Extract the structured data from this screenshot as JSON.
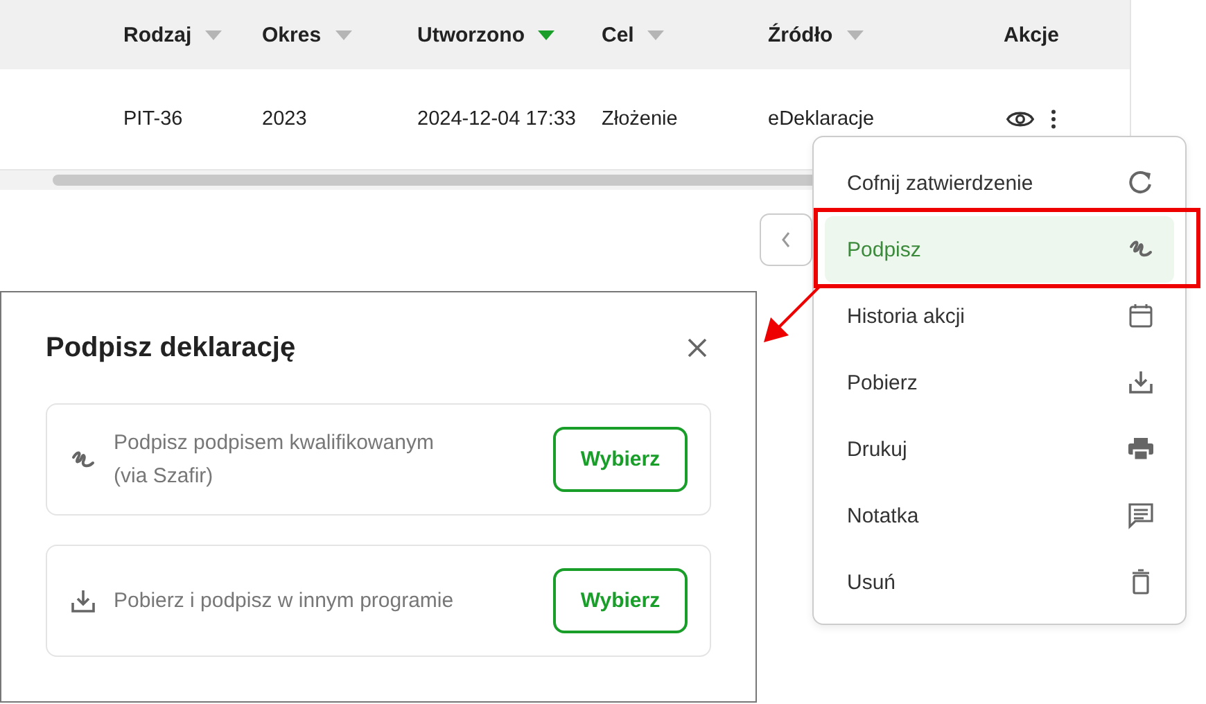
{
  "table": {
    "columns": [
      {
        "label": "Rodzaj",
        "sortable": true,
        "sorted": false
      },
      {
        "label": "Okres",
        "sortable": true,
        "sorted": false
      },
      {
        "label": "Utworzono",
        "sortable": true,
        "sorted": true
      },
      {
        "label": "Cel",
        "sortable": true,
        "sorted": false
      },
      {
        "label": "Źródło",
        "sortable": true,
        "sorted": false
      },
      {
        "label": "Akcje",
        "sortable": false,
        "sorted": false
      }
    ],
    "rows": [
      {
        "cells": [
          "PIT-36",
          "2023",
          "2024-12-04 17:33",
          "Złożenie",
          "eDeklaracje"
        ]
      }
    ]
  },
  "actions_menu": {
    "items": [
      {
        "label": "Cofnij zatwierdzenie",
        "kind": "refresh",
        "selected": false,
        "annotated": false
      },
      {
        "label": "Podpisz",
        "kind": "signature",
        "selected": true,
        "annotated": true
      },
      {
        "label": "Historia akcji",
        "kind": "calendar",
        "selected": false,
        "annotated": false
      },
      {
        "label": "Pobierz",
        "kind": "download",
        "selected": false,
        "annotated": false
      },
      {
        "label": "Drukuj",
        "kind": "printer",
        "selected": false,
        "annotated": false
      },
      {
        "label": "Notatka",
        "kind": "comment",
        "selected": false,
        "annotated": false
      },
      {
        "label": "Usuń",
        "kind": "trash",
        "selected": false,
        "annotated": false
      }
    ]
  },
  "dialog": {
    "title": "Podpisz deklarację",
    "options": [
      {
        "kind": "signature",
        "text": "Podpisz podpisem kwalifikowanym (via Szafir)",
        "button": "Wybierz"
      },
      {
        "kind": "download",
        "text": "Pobierz i podpisz w innym programie",
        "button": "Wybierz"
      }
    ]
  }
}
